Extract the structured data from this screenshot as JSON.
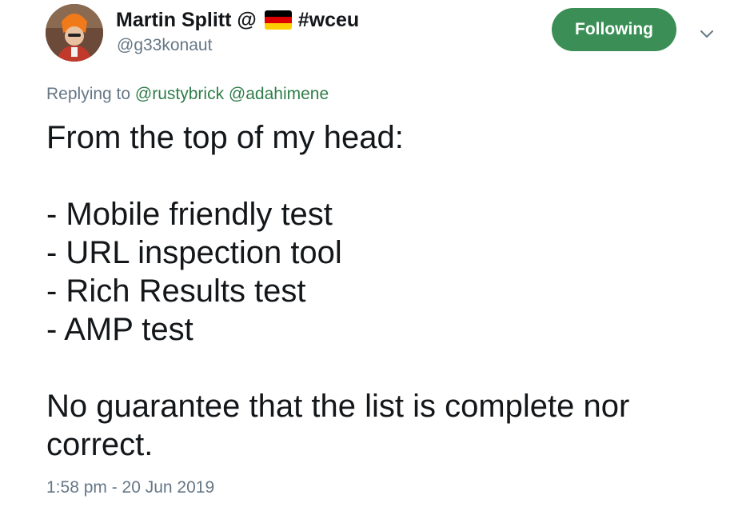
{
  "author": {
    "display_name": "Martin Splitt @",
    "flag_icon": "germany-flag-icon",
    "hashtag": "#wceu",
    "handle": "@g33konaut"
  },
  "follow_button": {
    "label": "Following",
    "color": "#3b8f56"
  },
  "menu": {
    "icon": "chevron-down-icon"
  },
  "reply": {
    "prefix": "Replying to",
    "mentions": [
      "@rustybrick",
      "@adahimene"
    ]
  },
  "tweet": {
    "intro": "From the top of my head:",
    "items": [
      "- Mobile friendly test",
      "- URL inspection tool",
      "- Rich Results test",
      "- AMP test"
    ],
    "closing_line_1": "No guarantee that the list is complete nor",
    "closing_line_2": "correct."
  },
  "meta": {
    "timestamp": "1:58 pm - 20 Jun 2019"
  },
  "colors": {
    "accent_green": "#3b8f56",
    "mention_green": "#2f7d49",
    "muted_text": "#657786",
    "primary_text": "#14171a"
  }
}
